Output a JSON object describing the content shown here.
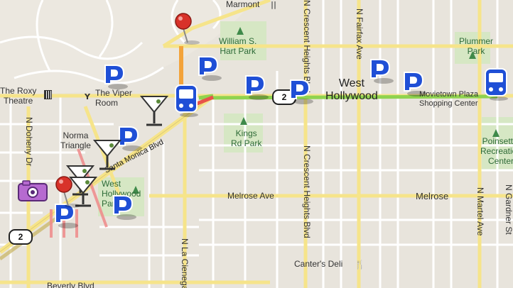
{
  "map": {
    "places": {
      "marmont": "Marmont",
      "hart_park": "William S.\nHart Park",
      "plummer_park": "Plummer\nPark",
      "roxy": "The Roxy\nTheatre",
      "viper_room": "The Viper\nRoom",
      "west_hollywood_big": "West\nHollywood",
      "movietown": "Movietown Plaza\nShopping Center",
      "norma_triangle": "Norma\nTriangle",
      "kings_rd_park": "Kings\nRd Park",
      "poinsettia": "Poinsettia\nRecreation\nCenter",
      "west_hollywood_park": "West\nHollywood\nPark",
      "canters": "Canter's Deli"
    },
    "streets": {
      "crescent_heights_top": "N Crescent Heights Blvd",
      "crescent_heights_bottom": "N Crescent Heights Blvd",
      "fairfax": "N Fairfax Ave",
      "gardner": "N Gardner St",
      "doheny": "N Doheny Dr",
      "la_cienega": "N La Cienega",
      "martel": "N Martel Ave",
      "santa_monica": "Santa Monica Blvd",
      "melrose_ave": "Melrose Ave",
      "melrose": "Melrose",
      "beverly": "Beverly Blvd"
    },
    "route_shields": {
      "shield_center": "2",
      "shield_left": "2"
    },
    "marker_icons": {
      "parking": "parking-icon",
      "bus": "bus-icon",
      "cocktail": "cocktail-icon",
      "pushpin": "pushpin-icon",
      "camera": "camera-icon"
    },
    "colors": {
      "background": "#e8e4dc",
      "street": "#ffffff",
      "arterial": "#f6e48a",
      "route_green": "#8fd34f",
      "route_red": "#e8534a",
      "route_orange": "#f3a33a",
      "parking_blue": "#1f4fd6"
    }
  }
}
